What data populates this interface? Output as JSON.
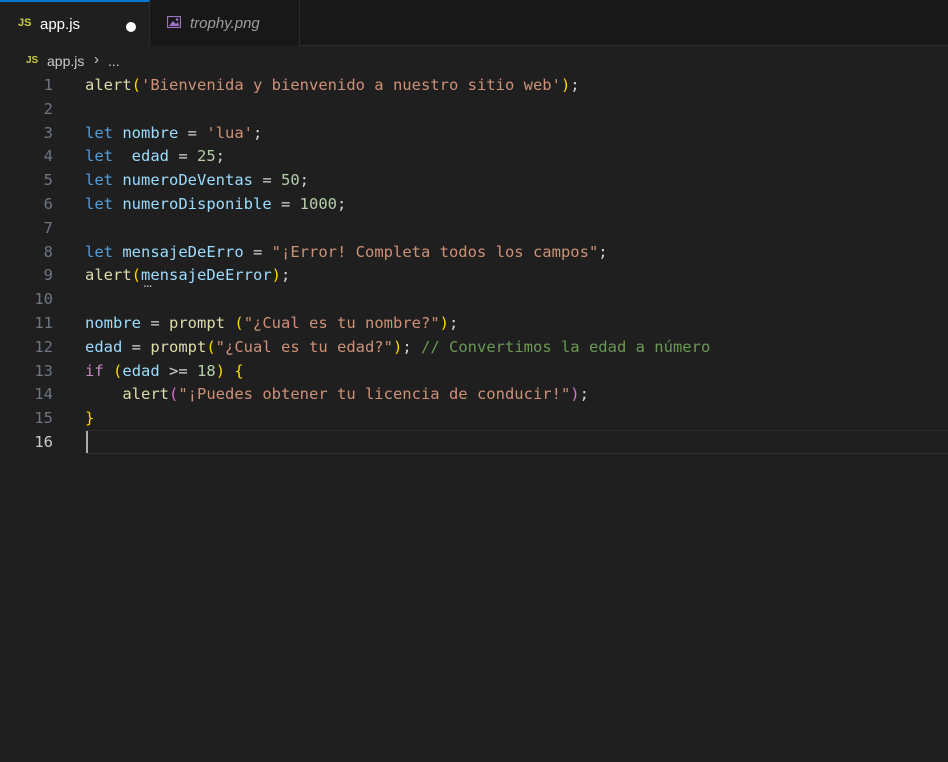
{
  "tabs": [
    {
      "icon": "js-file-icon",
      "icon_text": "JS",
      "label": "app.js",
      "dirty": true,
      "active": true
    },
    {
      "icon": "image-file-icon",
      "label": "trophy.png",
      "active": false
    }
  ],
  "breadcrumb": {
    "icon_text": "JS",
    "file": "app.js",
    "separator": "›",
    "more": "..."
  },
  "editor": {
    "active_line": 16,
    "lines": [
      {
        "n": "1",
        "tokens": [
          {
            "t": "alert",
            "c": "fn"
          },
          {
            "t": "(",
            "c": "p1"
          },
          {
            "t": "'Bienvenida y bienvenido a nuestro sitio web'",
            "c": "str"
          },
          {
            "t": ")",
            "c": "p1"
          },
          {
            "t": ";",
            "c": "op"
          }
        ]
      },
      {
        "n": "2",
        "tokens": []
      },
      {
        "n": "3",
        "tokens": [
          {
            "t": "let",
            "c": "kw"
          },
          {
            "t": " ",
            "c": "op"
          },
          {
            "t": "nombre",
            "c": "var"
          },
          {
            "t": " = ",
            "c": "op"
          },
          {
            "t": "'lua'",
            "c": "str"
          },
          {
            "t": ";",
            "c": "op"
          }
        ]
      },
      {
        "n": "4",
        "tokens": [
          {
            "t": "let",
            "c": "kw"
          },
          {
            "t": "  ",
            "c": "op"
          },
          {
            "t": "edad",
            "c": "var"
          },
          {
            "t": " = ",
            "c": "op"
          },
          {
            "t": "25",
            "c": "num"
          },
          {
            "t": ";",
            "c": "op"
          }
        ]
      },
      {
        "n": "5",
        "tokens": [
          {
            "t": "let",
            "c": "kw"
          },
          {
            "t": " ",
            "c": "op"
          },
          {
            "t": "numeroDeVentas",
            "c": "var"
          },
          {
            "t": " = ",
            "c": "op"
          },
          {
            "t": "50",
            "c": "num"
          },
          {
            "t": ";",
            "c": "op"
          }
        ]
      },
      {
        "n": "6",
        "tokens": [
          {
            "t": "let",
            "c": "kw"
          },
          {
            "t": " ",
            "c": "op"
          },
          {
            "t": "numeroDisponible",
            "c": "var"
          },
          {
            "t": " = ",
            "c": "op"
          },
          {
            "t": "1000",
            "c": "num"
          },
          {
            "t": ";",
            "c": "op"
          }
        ]
      },
      {
        "n": "7",
        "tokens": []
      },
      {
        "n": "8",
        "tokens": [
          {
            "t": "let",
            "c": "kw"
          },
          {
            "t": " ",
            "c": "op"
          },
          {
            "t": "mensajeDeErro",
            "c": "var"
          },
          {
            "t": " = ",
            "c": "op"
          },
          {
            "t": "\"¡Error! Completa todos los campos\"",
            "c": "str"
          },
          {
            "t": ";",
            "c": "op"
          }
        ]
      },
      {
        "n": "9",
        "tokens": [
          {
            "t": "alert",
            "c": "fn"
          },
          {
            "t": "(",
            "c": "p1"
          },
          {
            "t": "mensajeDeError",
            "c": "var"
          },
          {
            "t": ")",
            "c": "p1"
          },
          {
            "t": ";",
            "c": "op"
          }
        ]
      },
      {
        "n": "10",
        "tokens": []
      },
      {
        "n": "11",
        "tokens": [
          {
            "t": "nombre",
            "c": "var"
          },
          {
            "t": " = ",
            "c": "op"
          },
          {
            "t": "prompt",
            "c": "fn"
          },
          {
            "t": " ",
            "c": "op"
          },
          {
            "t": "(",
            "c": "p1"
          },
          {
            "t": "\"¿Cual es tu nombre?\"",
            "c": "str"
          },
          {
            "t": ")",
            "c": "p1"
          },
          {
            "t": ";",
            "c": "op"
          }
        ]
      },
      {
        "n": "12",
        "tokens": [
          {
            "t": "edad",
            "c": "var"
          },
          {
            "t": " = ",
            "c": "op"
          },
          {
            "t": "prompt",
            "c": "fn"
          },
          {
            "t": "(",
            "c": "p1"
          },
          {
            "t": "\"¿Cual es tu edad?\"",
            "c": "str"
          },
          {
            "t": ")",
            "c": "p1"
          },
          {
            "t": "; ",
            "c": "op"
          },
          {
            "t": "// Convertimos la edad a número",
            "c": "cmt"
          }
        ]
      },
      {
        "n": "13",
        "tokens": [
          {
            "t": "if",
            "c": "ctrl"
          },
          {
            "t": " ",
            "c": "op"
          },
          {
            "t": "(",
            "c": "p1"
          },
          {
            "t": "edad",
            "c": "var"
          },
          {
            "t": " >= ",
            "c": "op"
          },
          {
            "t": "18",
            "c": "num"
          },
          {
            "t": ")",
            "c": "p1"
          },
          {
            "t": " ",
            "c": "op"
          },
          {
            "t": "{",
            "c": "p1"
          }
        ]
      },
      {
        "n": "14",
        "tokens": [
          {
            "t": "    ",
            "c": "op"
          },
          {
            "t": "alert",
            "c": "fn"
          },
          {
            "t": "(",
            "c": "p2"
          },
          {
            "t": "\"¡Puedes obtener tu licencia de conducir!\"",
            "c": "str"
          },
          {
            "t": ")",
            "c": "p2"
          },
          {
            "t": ";",
            "c": "op"
          }
        ]
      },
      {
        "n": "15",
        "tokens": [
          {
            "t": "}",
            "c": "p1"
          }
        ]
      },
      {
        "n": "16",
        "tokens": []
      }
    ],
    "squiggle_text": "..."
  }
}
